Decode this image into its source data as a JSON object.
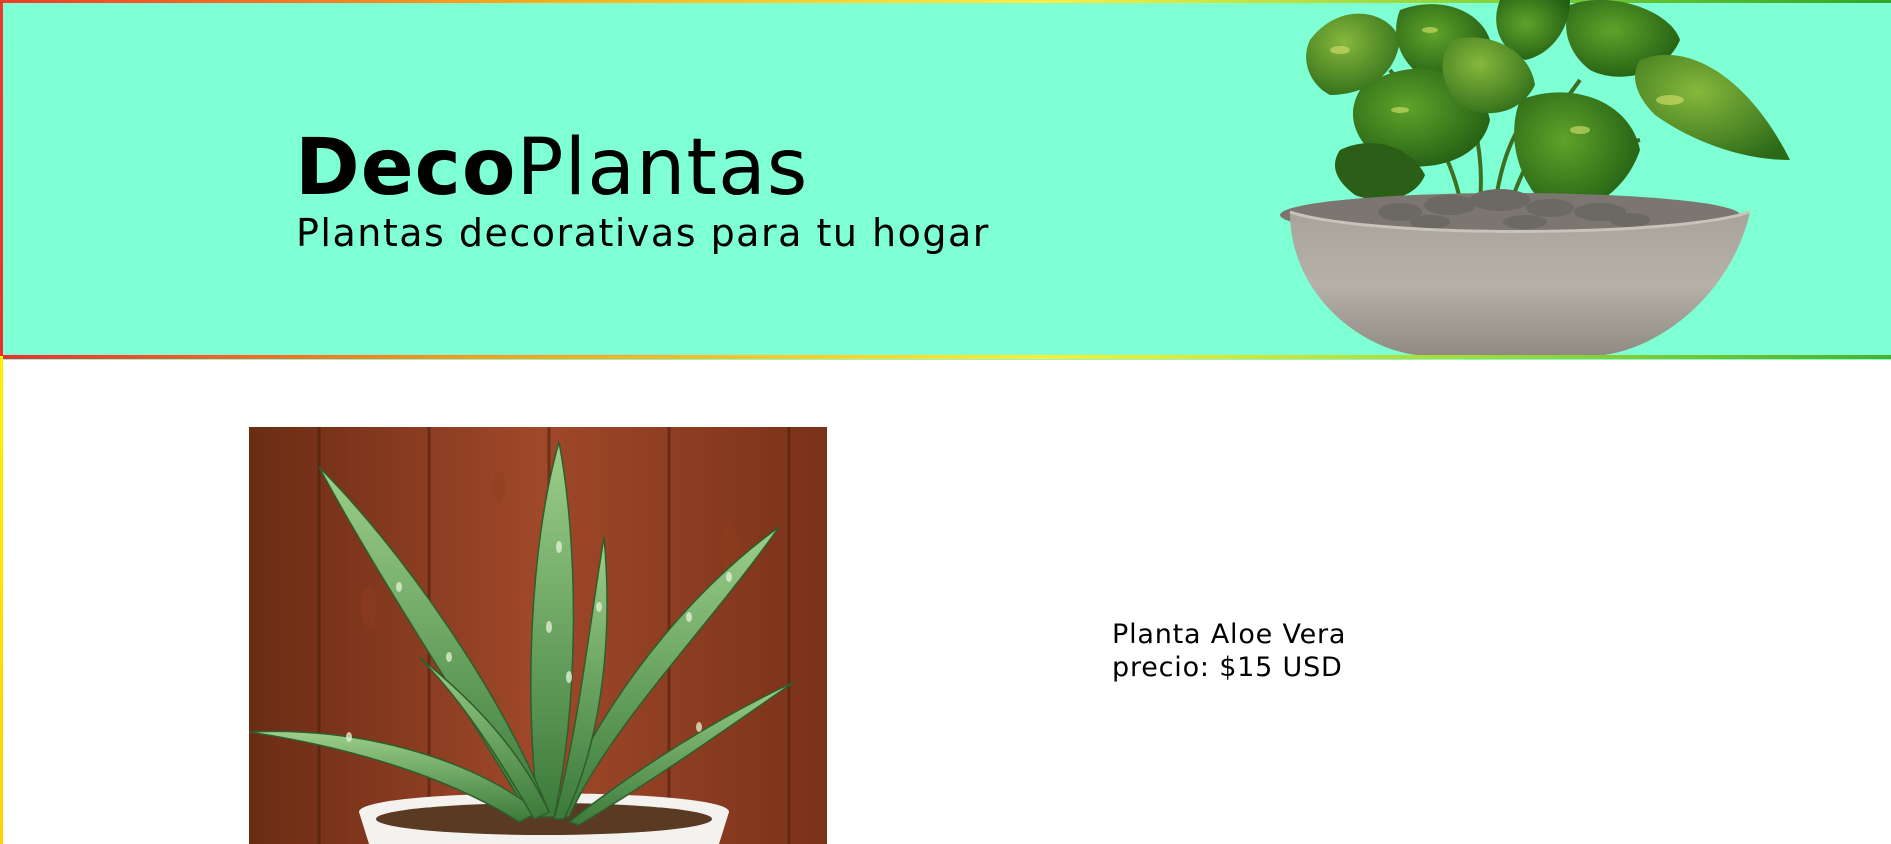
{
  "header": {
    "brand_bold": "Deco",
    "brand_light": "Plantas",
    "tagline": "Plantas decorativas para tu hogar",
    "background_color": "#7fffd4",
    "hero_image": "pothos-plant-in-concrete-bowl"
  },
  "product": {
    "name": "Planta Aloe Vera",
    "price": "precio: $15 USD",
    "image": "aloe-vera-in-white-pot"
  }
}
